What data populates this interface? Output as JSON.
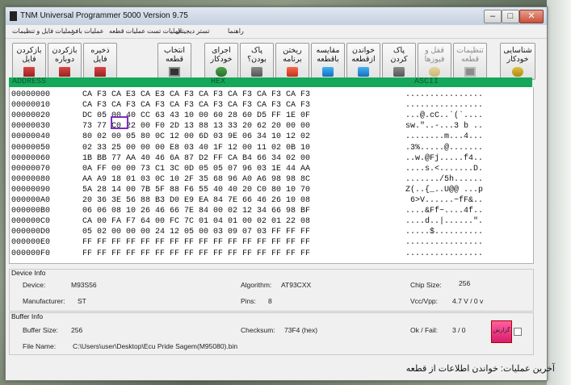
{
  "window": {
    "title": "TNM  Universal Programmer 5000   Version 9.75",
    "minimize": "‒",
    "maximize": "□",
    "close": "✕"
  },
  "menu": [
    "عملیات فایل و تنظیمات",
    "عملیات بافر",
    "عملیات قطعه",
    "عملیات تست",
    "تستر دیجیتال",
    "راهنما"
  ],
  "toolbar": [
    {
      "label": "بازکردن\nفایل",
      "icon": "open-file-icon"
    },
    {
      "label": "بازکردن\nدوباره",
      "icon": "reopen-file-icon"
    },
    {
      "label": "ذخیره\nفایل",
      "icon": "save-file-icon"
    },
    {
      "label": "انتخاب\nقطعه",
      "icon": "chip-icon"
    },
    {
      "label": "اجرای\nخودکار",
      "icon": "auto-run-icon"
    },
    {
      "label": "پاک\nبودن؟",
      "icon": "blank-check-icon"
    },
    {
      "label": "ریختن\nبرنامه",
      "icon": "write-icon"
    },
    {
      "label": "مقایسه\nباقطعه",
      "icon": "compare-icon"
    },
    {
      "label": "خواندن\nازقطعه",
      "icon": "read-icon"
    },
    {
      "label": "پاک\nکردن",
      "icon": "erase-icon"
    },
    {
      "label": "قفل و\nفیوزها",
      "icon": "lock-fuse-icon",
      "disabled": true
    },
    {
      "label": "تنظیمات\nقطعه",
      "icon": "device-settings-icon",
      "disabled": true
    },
    {
      "label": "شناسایی\nخودکار",
      "icon": "auto-detect-icon"
    }
  ],
  "hex_view": {
    "address_header": "ADDRESS",
    "hex_header": "HEX",
    "ascii_header": "ASCII",
    "rows": [
      {
        "addr": "00000000",
        "bytes": "CA F3 CA E3 CA E3 CA F3 CA F3 CA F3 CA F3 CA F3",
        "ascii": "................"
      },
      {
        "addr": "00000010",
        "bytes": "CA F3 CA F3 CA F3 CA F3 CA F3 CA F3 CA F3 CA F3",
        "ascii": "................"
      },
      {
        "addr": "00000020",
        "bytes": "DC 05 00 40 CC 63 43 10 00 60 28 60 D5 FF 1E 0F",
        "ascii": "...@.cC..`(`...."
      },
      {
        "addr": "00000030",
        "bytes": "73 77 C0 22 00 F0 2D 13 88 13 33 20 62 20 00 00",
        "ascii": "sw.\"..-...3 b .."
      },
      {
        "addr": "00000040",
        "bytes": "80 02 00 05 80 0C 12 00 6D 03 9E 06 34 10 12 02",
        "ascii": "........m...4..."
      },
      {
        "addr": "00000050",
        "bytes": "02 33 25 00 00 00 E8 03 40 1F 12 00 11 02 0B 10",
        "ascii": ".3%.....@......."
      },
      {
        "addr": "00000060",
        "bytes": "1B BB 77 AA 40 46 6A 87 D2 FF CA B4 66 34 02 00",
        "ascii": "..w.@Fj.....f4.."
      },
      {
        "addr": "00000070",
        "bytes": "0A FF 00 00 73 C1 3C 0D 05 05 07 96 03 1E 44 AA",
        "ascii": "....s.<.......D."
      },
      {
        "addr": "00000080",
        "bytes": "AA A9 18 01 03 0C 10 2F 35 68 96 A0 A6 98 98 8C",
        "ascii": "......./5h......"
      },
      {
        "addr": "00000090",
        "bytes": "5A 28 14 00 7B 5F 88 F6 55 40 40 20 C0 80 10 70",
        "ascii": "Z(..{_..U@@ ...p"
      },
      {
        "addr": "000000A0",
        "bytes": "20 36 3E 56 88 B3 D0 E9 EA 84 7E 66 46 26 10 08",
        "ascii": " 6>V......~fF&.."
      },
      {
        "addr": "000000B0",
        "bytes": "06 06 08 10 26 46 66 7E 84 00 02 12 34 66 98 BF",
        "ascii": "....&Ff~....4f.."
      },
      {
        "addr": "000000C0",
        "bytes": "CA 00 FA F7 64 00 FC 7C 01 04 01 00 02 01 22 08",
        "ascii": "....d..|......\"."
      },
      {
        "addr": "000000D0",
        "bytes": "05 02 00 00 00 24 12 05 00 03 09 07 03 FF FF FF",
        "ascii": ".....$.........."
      },
      {
        "addr": "000000E0",
        "bytes": "FF FF FF FF FF FF FF FF FF FF FF FF FF FF FF FF",
        "ascii": "................"
      },
      {
        "addr": "000000F0",
        "bytes": "FF FF FF FF FF FF FF FF FF FF FF FF FF FF FF FF",
        "ascii": "................"
      }
    ]
  },
  "device_info": {
    "title": "Device Info",
    "device_label": "Device:",
    "device": "M93S56",
    "manufacturer_label": "Manufacturer:",
    "manufacturer": "ST",
    "algorithm_label": "Algorithm:",
    "algorithm": "AT93CXX",
    "pins_label": "Pins:",
    "pins": "8",
    "chip_size_label": "Chip Size:",
    "chip_size": "256",
    "vcc_label": "Vcc/Vpp:",
    "vcc": "4.7 V / 0 v"
  },
  "buffer_info": {
    "title": "Buffer Info",
    "size_label": "Buffer Size:",
    "size": "256",
    "checksum_label": "Checksum:",
    "checksum": "73F4 (hex)",
    "okfail_label": "Ok / Fail:",
    "okfail": "3 / 0",
    "filename_label": "File Name:",
    "filename": "C:\\Users\\user\\Desktop\\Ecu  Pride Sagem(M95080).bin",
    "report_label": "گزارش"
  },
  "status_bar": "آخرین عملیات: خواندن اطلاعات از قطعه"
}
